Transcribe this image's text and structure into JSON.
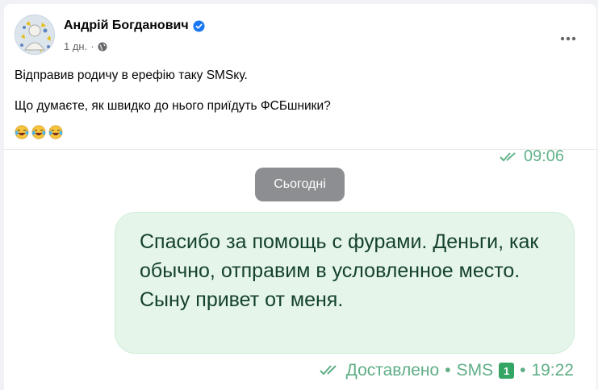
{
  "post": {
    "author": "Андрій Богданович",
    "time": "1 дн.",
    "separator": "·",
    "line1": "Відправив родичу в ерефію таку SMSку.",
    "line2": "Що думаєте, як швидко до нього приїдуть ФСБшники?",
    "emojis": [
      "laughing-crying-emoji",
      "laughing-crying-emoji",
      "laughing-crying-emoji"
    ]
  },
  "chat": {
    "prev_time": "09:06",
    "date_label": "Сьогодні",
    "message": "Спасибо за помощь с фурами. Деньги, как обычно, отправим в условленное место. Сыну привет от меня.",
    "status_text": "Доставлено",
    "channel": "SMS",
    "sim": "1",
    "time": "19:22",
    "bullet": "•"
  },
  "colors": {
    "accent": "#1877f2",
    "bubble_bg": "#e6f5ea",
    "status_green": "#5fae86",
    "date_pill": "#8d8e91"
  }
}
